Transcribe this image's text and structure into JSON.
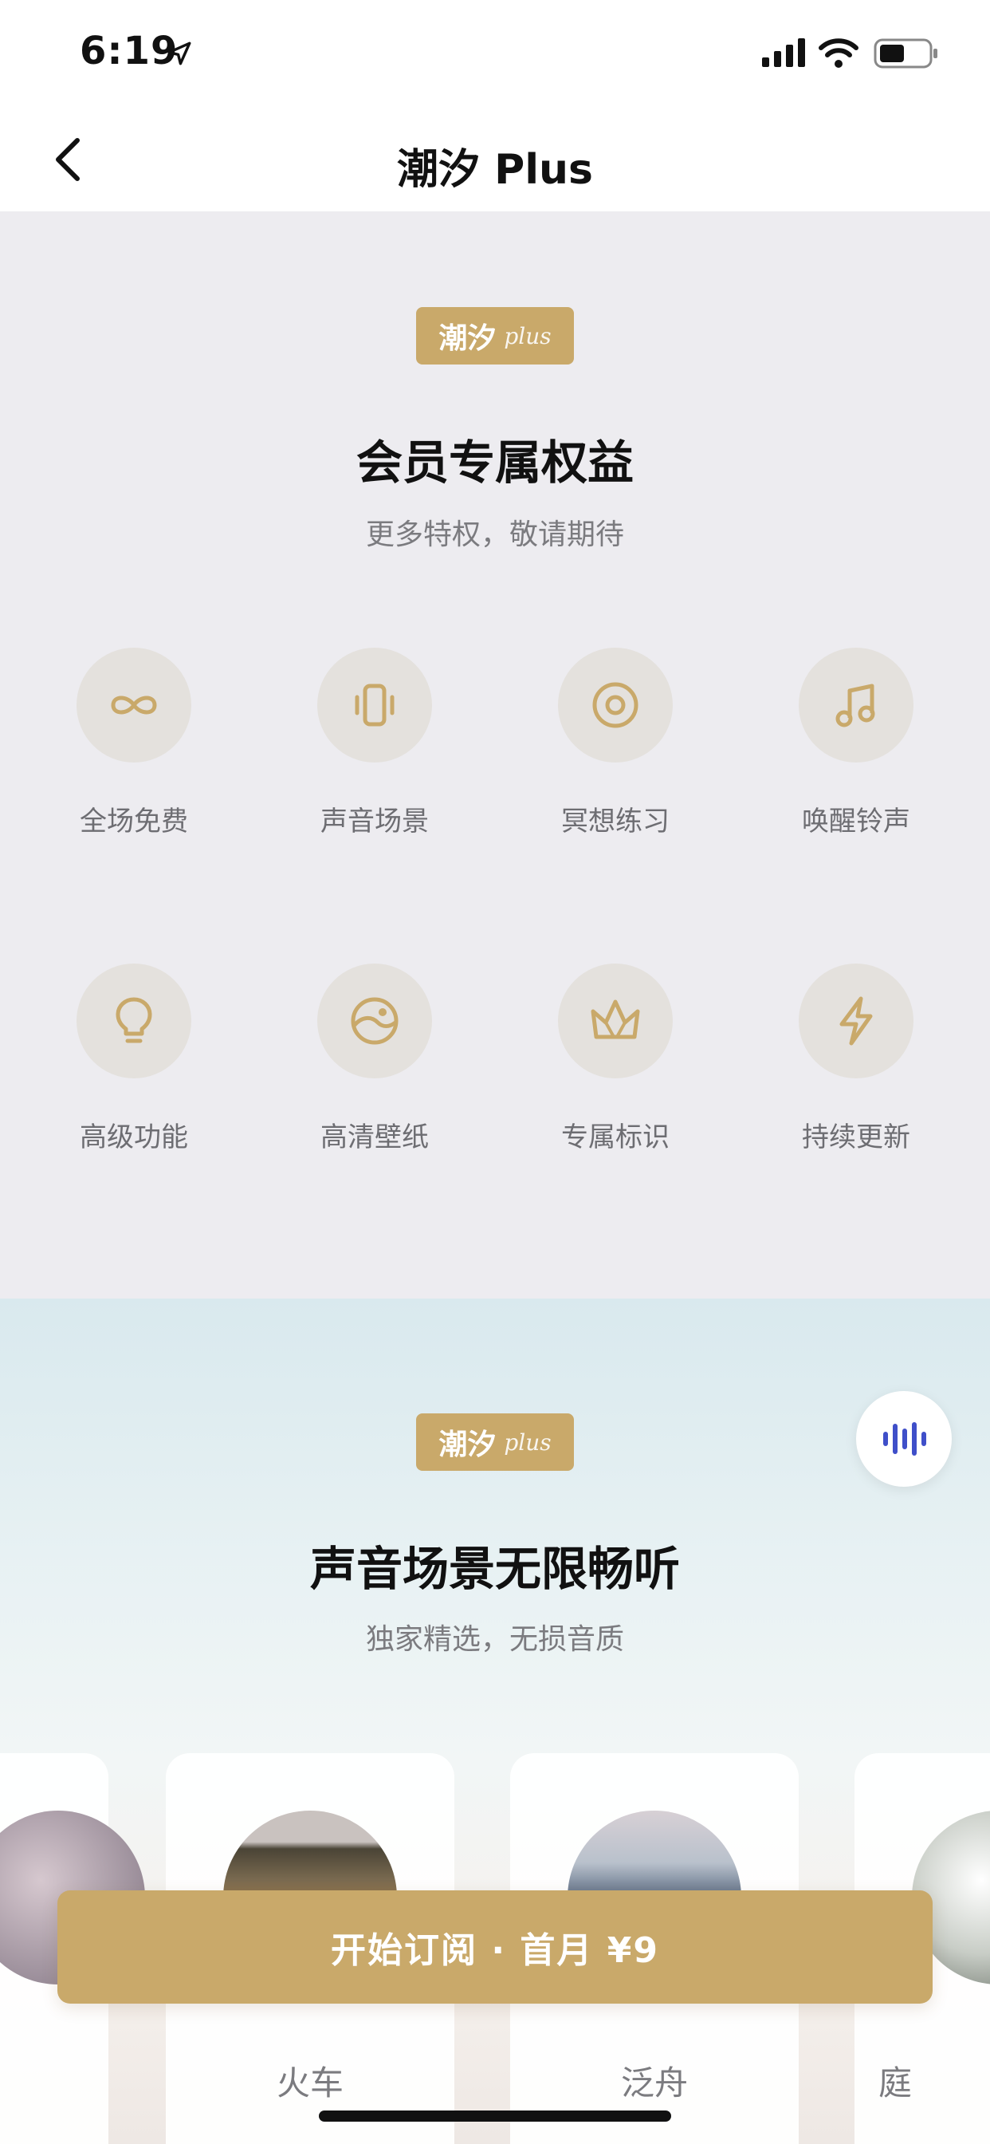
{
  "status_bar": {
    "time": "6:19"
  },
  "nav": {
    "title": "潮汐 Plus"
  },
  "badge": {
    "text": "潮汐",
    "script": "plus"
  },
  "benefits": {
    "title": "会员专属权益",
    "subtitle": "更多特权，敬请期待",
    "items": [
      {
        "label": "全场免费",
        "icon": "infinity-icon"
      },
      {
        "label": "声音场景",
        "icon": "vibrate-phone-icon"
      },
      {
        "label": "冥想练习",
        "icon": "target-circle-icon"
      },
      {
        "label": "唤醒铃声",
        "icon": "music-note-icon"
      },
      {
        "label": "高级功能",
        "icon": "lightbulb-icon"
      },
      {
        "label": "高清壁纸",
        "icon": "landscape-icon"
      },
      {
        "label": "专属标识",
        "icon": "crown-icon"
      },
      {
        "label": "持续更新",
        "icon": "lightning-icon"
      }
    ]
  },
  "scenes": {
    "title": "声音场景无限畅听",
    "subtitle": "独家精选，无损音质",
    "cards": [
      {
        "label": ""
      },
      {
        "label": "火车"
      },
      {
        "label": "泛舟"
      },
      {
        "label": "庭"
      }
    ]
  },
  "subscribe": {
    "label": "开始订阅 · 首月 ¥9"
  },
  "colors": {
    "gold": "#c9a96a",
    "icon_bg": "#e4e1dd",
    "section_bg": "#edecf0",
    "audio_blue": "#3f4fc9"
  }
}
